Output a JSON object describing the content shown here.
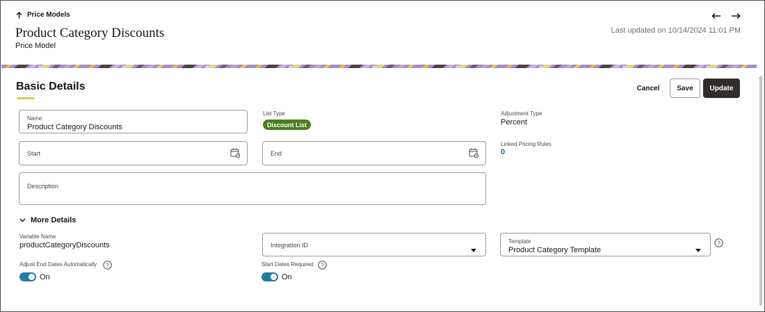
{
  "header": {
    "back_label": "Price Models",
    "title": "Product Category Discounts",
    "subtitle": "Price Model",
    "last_updated": "Last updated on 10/14/2024 11:01 PM"
  },
  "section": {
    "title": "Basic Details"
  },
  "actions": {
    "cancel": "Cancel",
    "save": "Save",
    "update": "Update"
  },
  "form": {
    "name_label": "Name",
    "name_value": "Product Category Discounts",
    "start_placeholder": "Start",
    "end_placeholder": "End",
    "description_placeholder": "Description",
    "list_type_label": "List Type",
    "list_type_value": "Discount List",
    "adjustment_type_label": "Adjustment Type",
    "adjustment_type_value": "Percent",
    "linked_rules_label": "Linked Pricing Rules",
    "linked_rules_value": "0"
  },
  "more_details": {
    "toggle_label": "More Details",
    "variable_name_label": "Variable Name",
    "variable_name_value": "productCategoryDiscounts",
    "integration_id_placeholder": "Integration ID",
    "template_label": "Template",
    "template_value": "Product Category Template",
    "adjust_end_dates_label": "Adjust End Dates Automatically",
    "adjust_end_dates_value": "On",
    "start_dates_required_label": "Start Dates Required",
    "start_dates_required_value": "On"
  },
  "icons": {
    "back": "arrow-up-icon",
    "prev": "arrow-left-icon",
    "next": "arrow-right-icon",
    "calendar": "calendar-icon",
    "dropdown": "caret-down-icon",
    "help": "help-icon",
    "chevron": "chevron-down-icon"
  },
  "colors": {
    "badge": "#4b7e1f",
    "toggle": "#227e9e",
    "link": "#1a6f8a",
    "primary_button": "#312d2a",
    "accent_underline": "#e9c15a"
  }
}
